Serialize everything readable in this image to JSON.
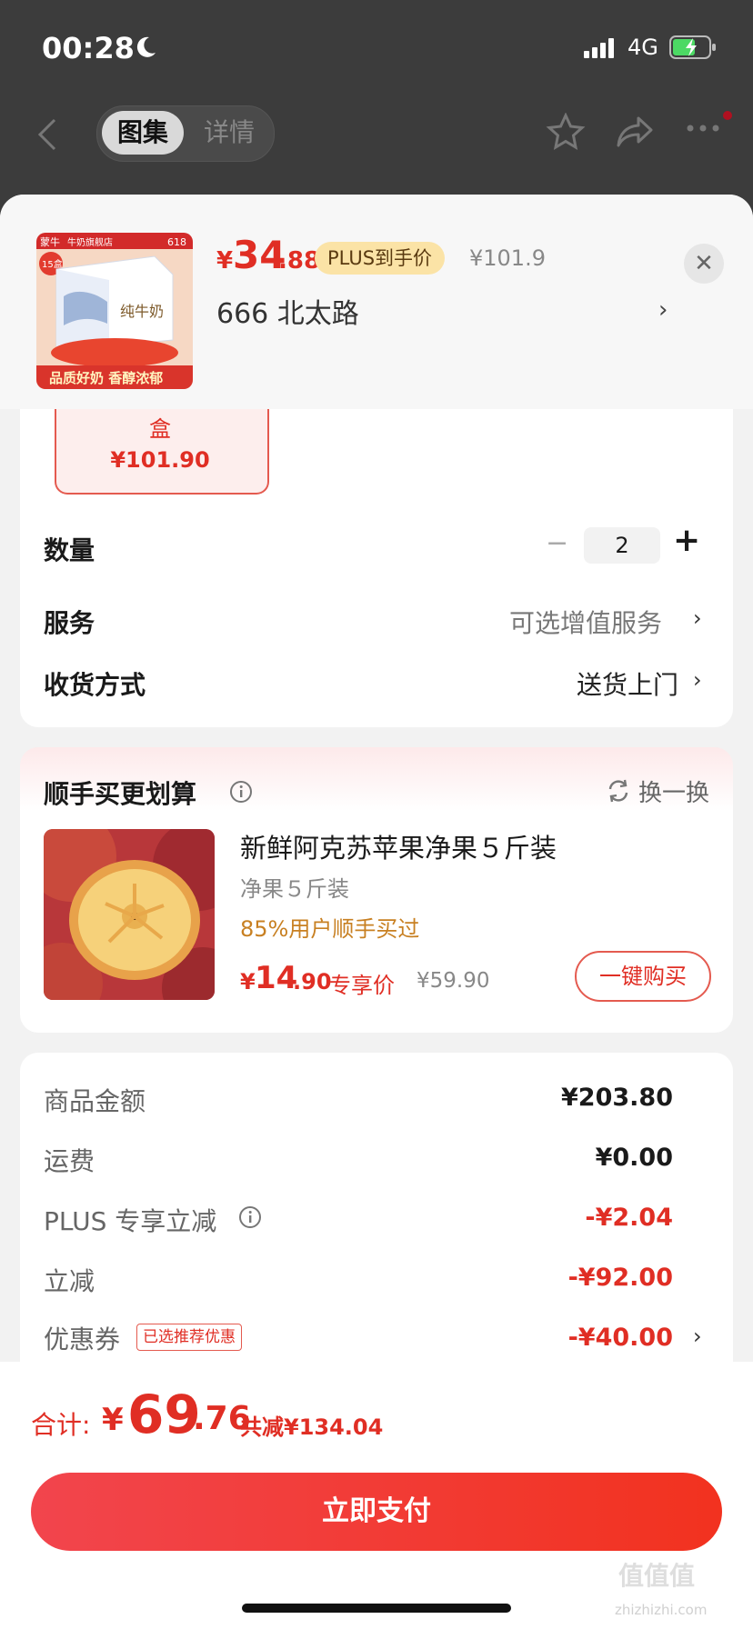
{
  "status_bar": {
    "time": "00:28",
    "network": "4G"
  },
  "nav": {
    "tab_gallery": "图集",
    "tab_detail": "详情"
  },
  "product": {
    "price_symbol": "¥",
    "price_integer": "34",
    "price_decimal": ".88",
    "plus_tag": "PLUS到手价",
    "original_price": "¥101.9",
    "address": "666  北太路",
    "thumbnail_brand": "蒙牛",
    "thumbnail_store": "牛奶旗舰店",
    "thumbnail_618": "618",
    "thumbnail_badge": "15盒",
    "thumbnail_milk_label": "纯牛奶",
    "thumbnail_slogan": "品质好奶 香醇浓郁"
  },
  "spec": {
    "line1": "盒",
    "line2": "¥101.90"
  },
  "quantity": {
    "label": "数量",
    "value": "2",
    "minus": "−",
    "plus": "+"
  },
  "service": {
    "label": "服务",
    "value": "可选增值服务"
  },
  "delivery": {
    "label": "收货方式",
    "value": "送货上门"
  },
  "bundle": {
    "title": "顺手买更划算",
    "refresh_label": "换一换",
    "item": {
      "title": "新鲜阿克苏苹果净果５斤装",
      "spec": "净果５斤装",
      "social_proof": "85%用户顺手买过",
      "price_symbol": "¥",
      "price_integer": "14",
      "price_decimal": ".90",
      "price_tag": "专享价",
      "original_price": "¥59.90",
      "buy_label": "一键购买"
    }
  },
  "summary": {
    "items_label": "商品金额",
    "items_value": "¥203.80",
    "shipping_label": "运费",
    "shipping_value": "¥0.00",
    "plus_label": "PLUS 专享立减",
    "plus_value": "-¥2.04",
    "cut_label": "立减",
    "cut_value": "-¥92.00",
    "coupon_label": "优惠券",
    "coupon_tag": "已选推荐优惠",
    "coupon_value": "-¥40.00"
  },
  "footer": {
    "total_label": "合计:",
    "total_symbol": "¥",
    "total_integer": "69",
    "total_decimal": ".76",
    "total_saving": "共减¥134.04",
    "pay_label": "立即支付"
  },
  "watermark": {
    "main": "值值值",
    "sub": "zhizhizhi.com"
  },
  "colors": {
    "accent": "#e02e24",
    "plus_gold": "#fbe3a6",
    "social_orange": "#c88022"
  },
  "icons": [
    "moon-icon",
    "signal-icon",
    "battery-icon",
    "back-icon",
    "star-icon",
    "share-icon",
    "more-icon",
    "close-icon",
    "info-icon",
    "refresh-icon",
    "chevron-right-icon"
  ]
}
